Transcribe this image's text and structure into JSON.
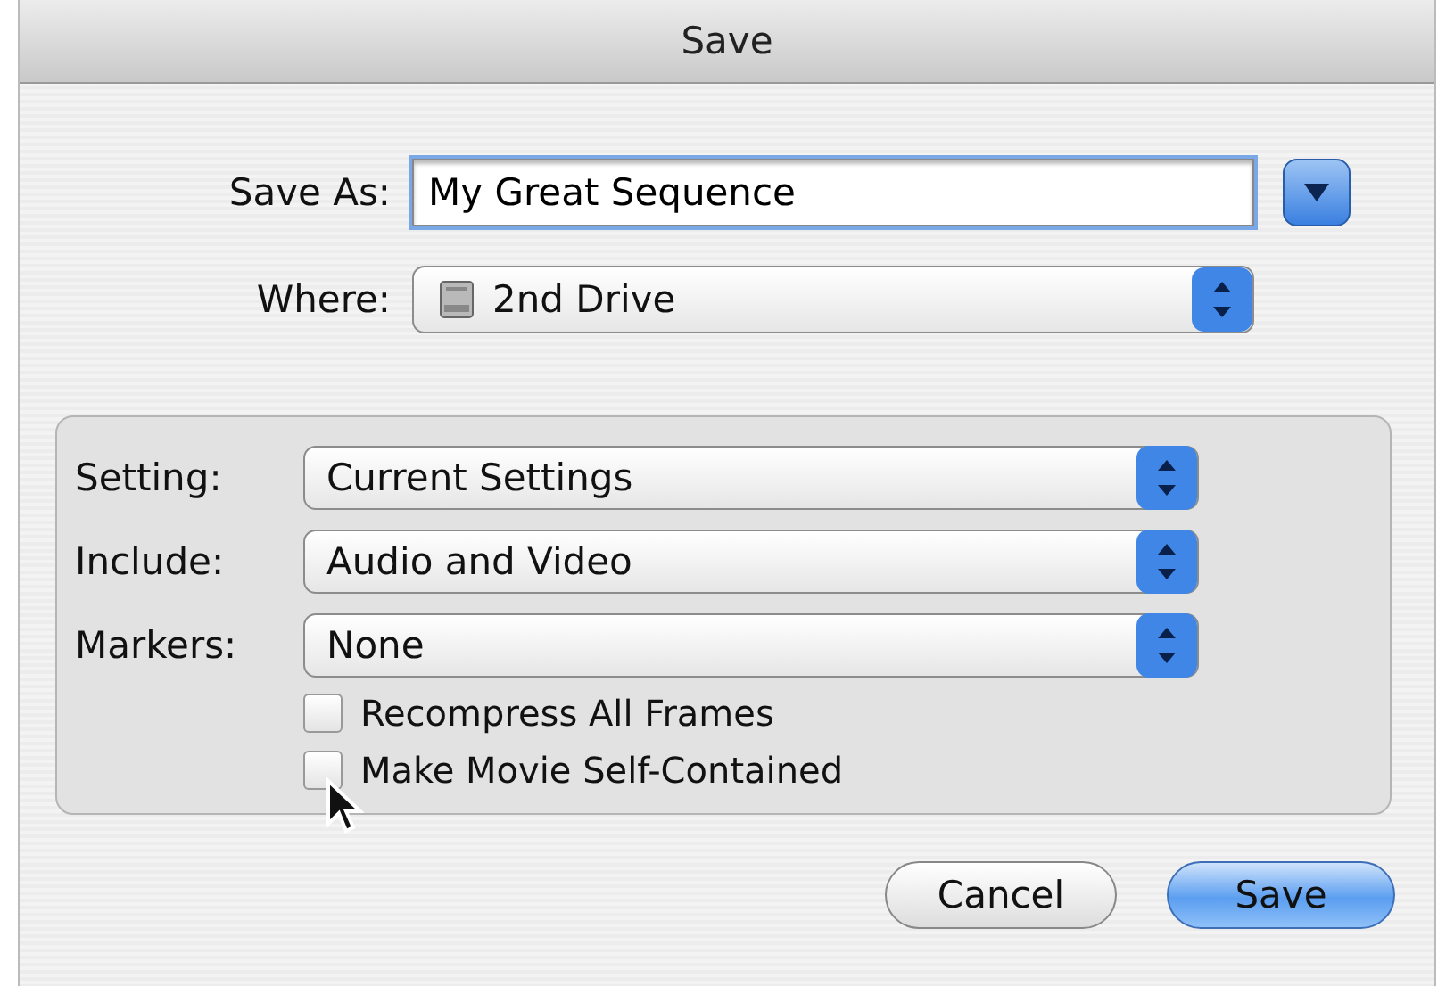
{
  "window": {
    "title": "Save"
  },
  "save_as": {
    "label": "Save As:",
    "value": "My Great Sequence"
  },
  "where": {
    "label": "Where:",
    "value": "2nd Drive"
  },
  "options": [
    {
      "label": "Setting:",
      "value": "Current Settings"
    },
    {
      "label": "Include:",
      "value": "Audio and Video"
    },
    {
      "label": "Markers:",
      "value": "None"
    }
  ],
  "checkboxes": [
    {
      "label": "Recompress All Frames",
      "checked": false
    },
    {
      "label": "Make Movie Self-Contained",
      "checked": false
    }
  ],
  "buttons": [
    {
      "label": "Cancel",
      "kind": "normal"
    },
    {
      "label": "Save",
      "kind": "default"
    }
  ]
}
